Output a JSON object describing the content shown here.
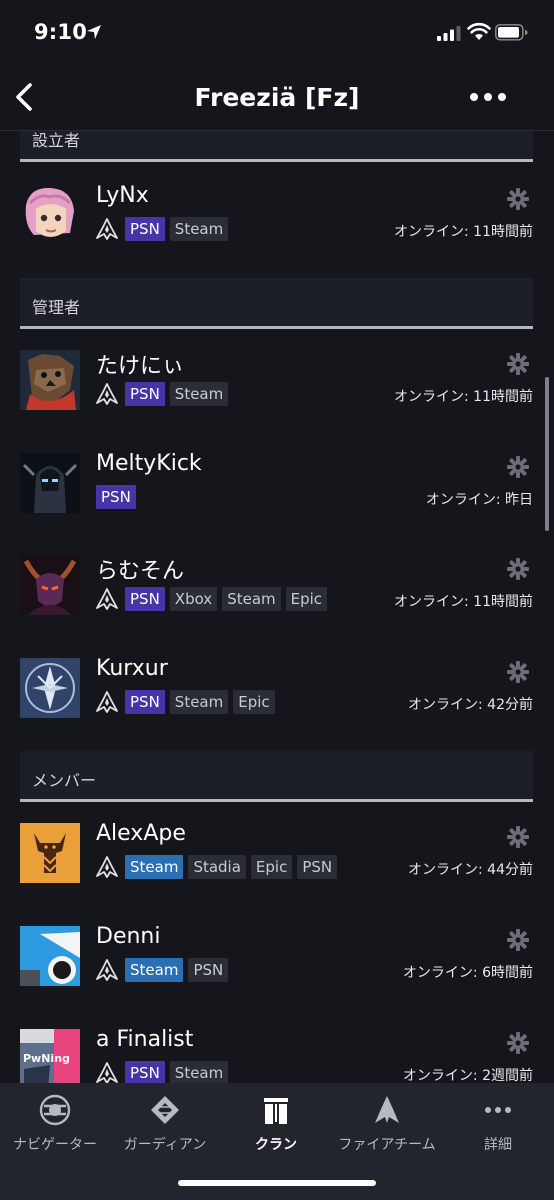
{
  "status_bar": {
    "time": "9:10"
  },
  "header": {
    "title": "Freeziä [Fz]"
  },
  "sections": [
    {
      "label": "設立者"
    },
    {
      "label": "管理者"
    },
    {
      "label": "メンバー"
    }
  ],
  "members": [
    {
      "name": "LyNx",
      "platforms": [
        "PSN",
        "Steam"
      ],
      "online": "オンライン: 11時間前",
      "primary": "PSN"
    },
    {
      "name": "たけにぃ",
      "platforms": [
        "PSN",
        "Steam"
      ],
      "online": "オンライン: 11時間前",
      "primary": "PSN"
    },
    {
      "name": "MeltyKick",
      "platforms": [
        "PSN"
      ],
      "online": "オンライン: 昨日",
      "primary": "PSN"
    },
    {
      "name": "らむそん",
      "platforms": [
        "PSN",
        "Xbox",
        "Steam",
        "Epic"
      ],
      "online": "オンライン: 11時間前",
      "primary": "PSN"
    },
    {
      "name": "Kurxur",
      "platforms": [
        "PSN",
        "Steam",
        "Epic"
      ],
      "online": "オンライン: 42分前",
      "primary": "PSN"
    },
    {
      "name": "AlexApe",
      "platforms": [
        "Steam",
        "Stadia",
        "Epic",
        "PSN"
      ],
      "online": "オンライン: 44分前",
      "primary": "Steam"
    },
    {
      "name": "Denni",
      "platforms": [
        "Steam",
        "PSN"
      ],
      "online": "オンライン: 6時間前",
      "primary": "Steam"
    },
    {
      "name": "a Finalist",
      "platforms": [
        "PSN",
        "Steam"
      ],
      "online": "オンライン: 2週間前",
      "primary": "PSN",
      "avatar_text": "PwNing"
    }
  ],
  "tabs": [
    {
      "label": "ナビゲーター",
      "icon": "navigator-icon"
    },
    {
      "label": "ガーディアン",
      "icon": "guardian-icon"
    },
    {
      "label": "クラン",
      "icon": "clan-icon",
      "active": true
    },
    {
      "label": "ファイアチーム",
      "icon": "fireteam-icon"
    },
    {
      "label": "詳細",
      "icon": "more-icon"
    }
  ],
  "colors": {
    "background": "#14161b",
    "psn": "#4535a8",
    "steam": "#2a6fb4",
    "chip": "#2a2d34",
    "tabbar": "#22252c"
  }
}
